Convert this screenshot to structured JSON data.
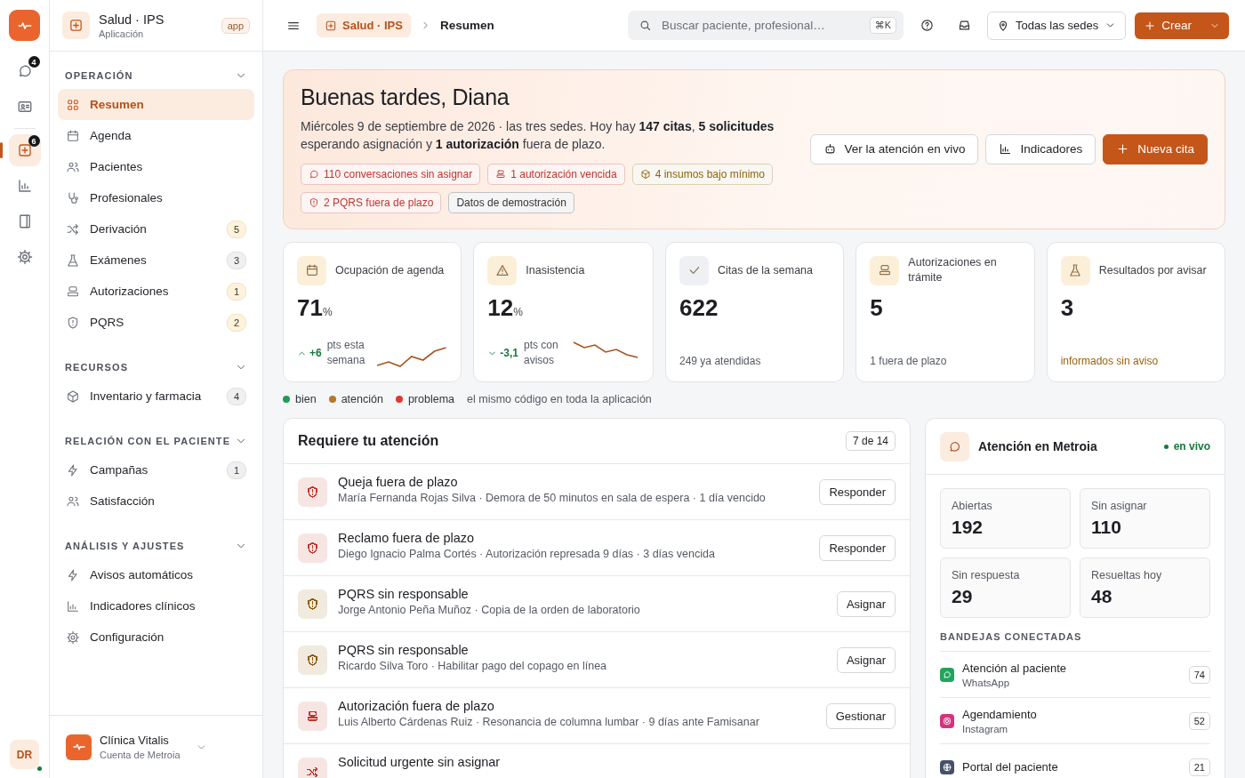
{
  "rail": {
    "items": [
      {
        "badge": "4",
        "selected": false
      },
      {
        "selected": false
      },
      {
        "badge": "6",
        "selected": true
      },
      {
        "selected": false
      },
      {
        "selected": false
      },
      {
        "selected": false
      }
    ],
    "avatar": {
      "initials": "DR",
      "online": true
    }
  },
  "sidebar": {
    "app": {
      "name": "Salud · IPS",
      "subtitle": "Aplicación",
      "tag": "app"
    },
    "groups": [
      {
        "heading": "OPERACIÓN",
        "expanded": true,
        "items": [
          {
            "label": "Resumen",
            "selected": true
          },
          {
            "label": "Agenda",
            "selected": false
          },
          {
            "label": "Pacientes",
            "selected": false
          },
          {
            "label": "Profesionales",
            "selected": false
          },
          {
            "label": "Derivación",
            "selected": false,
            "count": "5",
            "color": "#fdf3dd"
          },
          {
            "label": "Exámenes",
            "selected": false,
            "count": "3",
            "color": "#eef0f3"
          },
          {
            "label": "Autorizaciones",
            "selected": false,
            "count": "1",
            "color": "#fdf3dd"
          },
          {
            "label": "PQRS",
            "selected": false,
            "count": "2",
            "color": "#fdf3dd"
          }
        ]
      },
      {
        "heading": "RECURSOS",
        "expanded": true,
        "items": [
          {
            "label": "Inventario y farmacia",
            "selected": false,
            "count": "4",
            "color": "#eef0f3"
          }
        ]
      },
      {
        "heading": "RELACIÓN CON EL PACIENTE",
        "expanded": true,
        "items": [
          {
            "label": "Campañas",
            "selected": false,
            "count": "1",
            "color": "#eef0f3"
          },
          {
            "label": "Satisfacción",
            "selected": false
          }
        ]
      },
      {
        "heading": "ANÁLISIS Y AJUSTES",
        "expanded": true,
        "items": [
          {
            "label": "Avisos automáticos",
            "selected": false
          },
          {
            "label": "Indicadores clínicos",
            "selected": false
          },
          {
            "label": "Configuración",
            "selected": false
          }
        ]
      }
    ],
    "account": {
      "name": "Clínica Vitalis",
      "subtitle": "Cuenta de Metroia"
    }
  },
  "topbar": {
    "breadcrumb": [
      {
        "label": "Salud · IPS"
      },
      {
        "label": "Resumen"
      }
    ],
    "search": {
      "placeholder": "Buscar paciente, profesional…",
      "shortcut": "⌘K"
    },
    "site_select": "Todas las sedes",
    "create_button": "Crear"
  },
  "greeting": {
    "title": "Buenas tardes, Diana",
    "text": "Miércoles 9 de septiembre de 2026 · las tres sedes. Hoy hay **147 citas**, **5 solicitudes** esperando asignación y **1 autorización** fuera de plazo.",
    "chips": [
      {
        "label": "110 conversaciones sin asignar",
        "color": "#c0362c"
      },
      {
        "label": "1 autorización vencida",
        "color": "#c0362c"
      },
      {
        "label": "4 insumos bajo mínimo",
        "color": "#8f6508"
      },
      {
        "label": "2 PQRS fuera de plazo",
        "color": "#c0362c"
      },
      {
        "label": "Datos de demostración",
        "color": "#33363b"
      }
    ],
    "actions": [
      {
        "label": "Ver la atención en vivo",
        "kind": "outline"
      },
      {
        "label": "Indicadores",
        "kind": "outline"
      },
      {
        "label": "Nueva cita",
        "kind": "primary"
      }
    ]
  },
  "kpis": [
    {
      "label": "Ocupación de agenda",
      "value": "71",
      "unit": "%",
      "color": "#fcefd9",
      "kind": "rising",
      "delta": "+6",
      "note": "pts esta semana"
    },
    {
      "label": "Inasistencia",
      "value": "12",
      "unit": "%",
      "color": "#fcefd9",
      "kind": "falling",
      "delta": "-3,1",
      "note": "pts con avisos"
    },
    {
      "label": "Citas de la semana",
      "value": "622",
      "color": "#eef0f3",
      "kind": "note",
      "note": {
        "text": "249 ya atendidas",
        "color": "#555a62"
      }
    },
    {
      "label": "Autorizaciones en trámite",
      "value": "5",
      "color": "#fcefd9",
      "kind": "note",
      "note": {
        "text": "1 fuera de plazo",
        "color": "#555a62"
      }
    },
    {
      "label": "Resultados por avisar",
      "value": "3",
      "color": "#fcefd9",
      "kind": "note",
      "note": {
        "text": "informados sin aviso",
        "color": "#9b620d"
      }
    }
  ],
  "legend": {
    "items": [
      {
        "label": "bien",
        "color": "#1f9d55"
      },
      {
        "label": "atención",
        "color": "#b7791f"
      },
      {
        "label": "problema",
        "color": "#e0392b"
      }
    ],
    "note": "el mismo código en toda la aplicación"
  },
  "attention": {
    "title": "Requiere tu atención",
    "count": "7 de 14",
    "items": [
      {
        "title": "Queja fuera de plazo",
        "detail": "María Fernanda Rojas Silva · Demora de 50 minutos en sala de espera · 1 día vencido",
        "color": "#c0362c",
        "action": "Responder"
      },
      {
        "title": "Reclamo fuera de plazo",
        "detail": "Diego Ignacio Palma Cortés · Autorización represada 9 días · 3 días vencida",
        "color": "#c0362c",
        "action": "Responder"
      },
      {
        "title": "PQRS sin responsable",
        "detail": "Jorge Antonio Peña Muñoz · Copia de la orden de laboratorio",
        "color": "#8a5a08",
        "action": "Asignar"
      },
      {
        "title": "PQRS sin responsable",
        "detail": "Ricardo Silva Toro · Habilitar pago del copago en línea",
        "color": "#8a5a08",
        "action": "Asignar"
      },
      {
        "title": "Autorización fuera de plazo",
        "detail": "Luis Alberto Cárdenas Ruiz · Resonancia de columna lumbar · 9 días ante Famisanar",
        "color": "#c0362c",
        "action": "Gestionar"
      },
      {
        "title": "Solicitud urgente sin asignar",
        "color": "#c0362c"
      }
    ]
  },
  "live": {
    "title": "Atención en Metroia",
    "status": "en vivo",
    "stats": [
      {
        "label": "Abiertas",
        "value": "192"
      },
      {
        "label": "Sin asignar",
        "value": "110"
      },
      {
        "label": "Sin respuesta",
        "value": "29"
      },
      {
        "label": "Resueltas hoy",
        "value": "48"
      }
    ],
    "inboxes_heading": "BANDEJAS CONECTADAS",
    "inboxes": [
      {
        "name": "Atención al paciente",
        "channel": "WhatsApp",
        "count": "74",
        "color": "#22a45d"
      },
      {
        "name": "Agendamiento",
        "channel": "Instagram",
        "count": "52",
        "color": "#d6337f"
      },
      {
        "name": "Portal del paciente",
        "count": "21",
        "color": "#475069"
      }
    ]
  }
}
